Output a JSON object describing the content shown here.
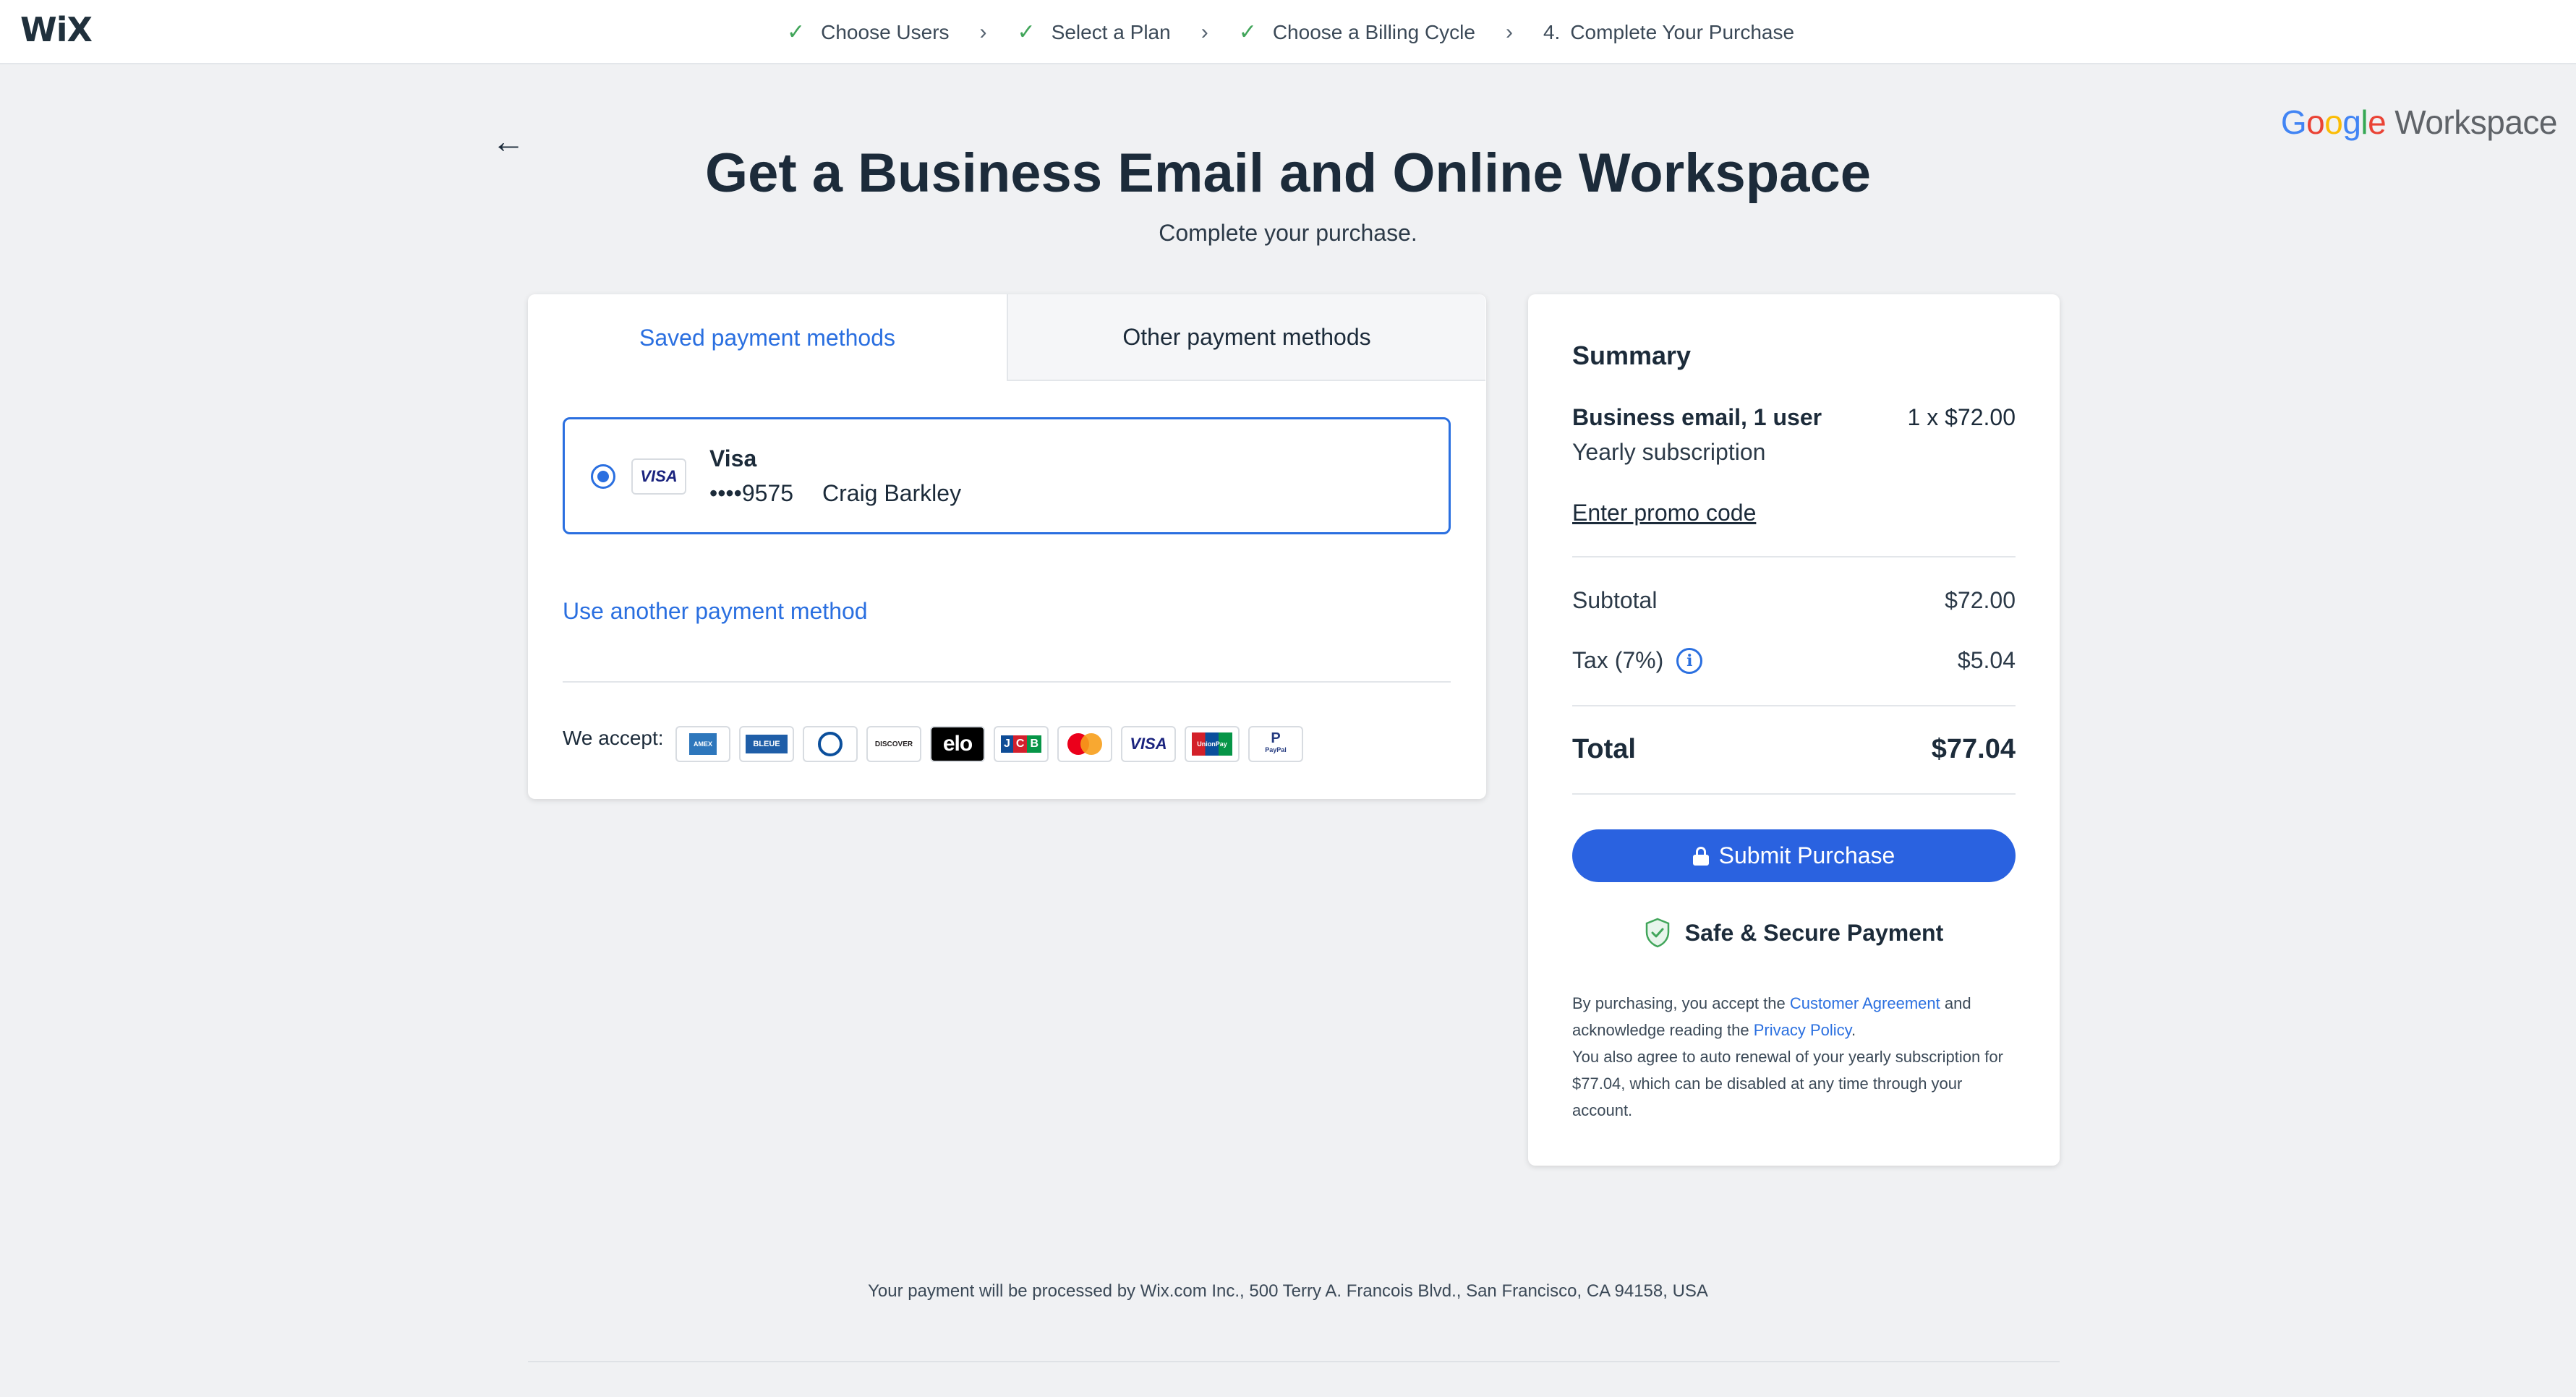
{
  "brand": {
    "logo": "WiX",
    "partner_g": [
      "G",
      "o",
      "o",
      "g",
      "l",
      "e"
    ],
    "partner_product": "Workspace"
  },
  "steps": [
    {
      "label": "Choose Users",
      "done": true
    },
    {
      "label": "Select a Plan",
      "done": true
    },
    {
      "label": "Choose a Billing Cycle",
      "done": true
    },
    {
      "label": "Complete Your Purchase",
      "done": false,
      "number": "4."
    }
  ],
  "page": {
    "title": "Get a Business Email and Online Workspace",
    "subtitle": "Complete your purchase."
  },
  "payment": {
    "tabs": [
      {
        "label": "Saved payment methods",
        "active": true
      },
      {
        "label": "Other payment methods",
        "active": false
      }
    ],
    "saved_card": {
      "selected": true,
      "logo_text": "VISA",
      "brand": "Visa",
      "number": "••••9575",
      "holder": "Craig Barkley"
    },
    "use_another_label": "Use another payment method",
    "we_accept_label": "We accept:",
    "accepted_methods": [
      {
        "name": "amex-icon",
        "text": "AMERICAN EXPRESS"
      },
      {
        "name": "carte-bleue-icon",
        "text": "BLEUE"
      },
      {
        "name": "diners-club-icon",
        "text": ""
      },
      {
        "name": "discover-icon",
        "text": "DISCOVER"
      },
      {
        "name": "elo-icon",
        "text": "elo"
      },
      {
        "name": "jcb-icon",
        "text": "JCB"
      },
      {
        "name": "mastercard-icon",
        "text": ""
      },
      {
        "name": "visa-icon",
        "text": "VISA"
      },
      {
        "name": "unionpay-icon",
        "text": "UnionPay"
      },
      {
        "name": "paypal-icon",
        "text": "PayPal"
      }
    ]
  },
  "summary": {
    "title": "Summary",
    "item_name": "Business email, 1 user",
    "item_qty_price": "1 x $72.00",
    "item_sub": "Yearly subscription",
    "promo_label": "Enter promo code",
    "subtotal_label": "Subtotal",
    "subtotal_value": "$72.00",
    "tax_label": "Tax (7%)",
    "tax_value": "$5.04",
    "total_label": "Total",
    "total_value": "$77.04",
    "submit_label": "Submit Purchase",
    "secure_label": "Safe & Secure Payment",
    "legal": {
      "p1": "By purchasing, you accept the ",
      "link1": "Customer Agreement",
      "p2": " and acknowledge reading the ",
      "link2": "Privacy Policy",
      "p3": ".",
      "p4": "You also agree to auto renewal of your yearly subscription for $77.04, which can be disabled at any time through your account."
    }
  },
  "footer": {
    "note": "Your payment will be processed by Wix.com Inc., 500 Terry A. Francois Blvd., San Francisco, CA 94158, USA"
  },
  "colors": {
    "accent": "#2a6fe0",
    "check": "#41a55a",
    "background": "#f0f1f3"
  }
}
